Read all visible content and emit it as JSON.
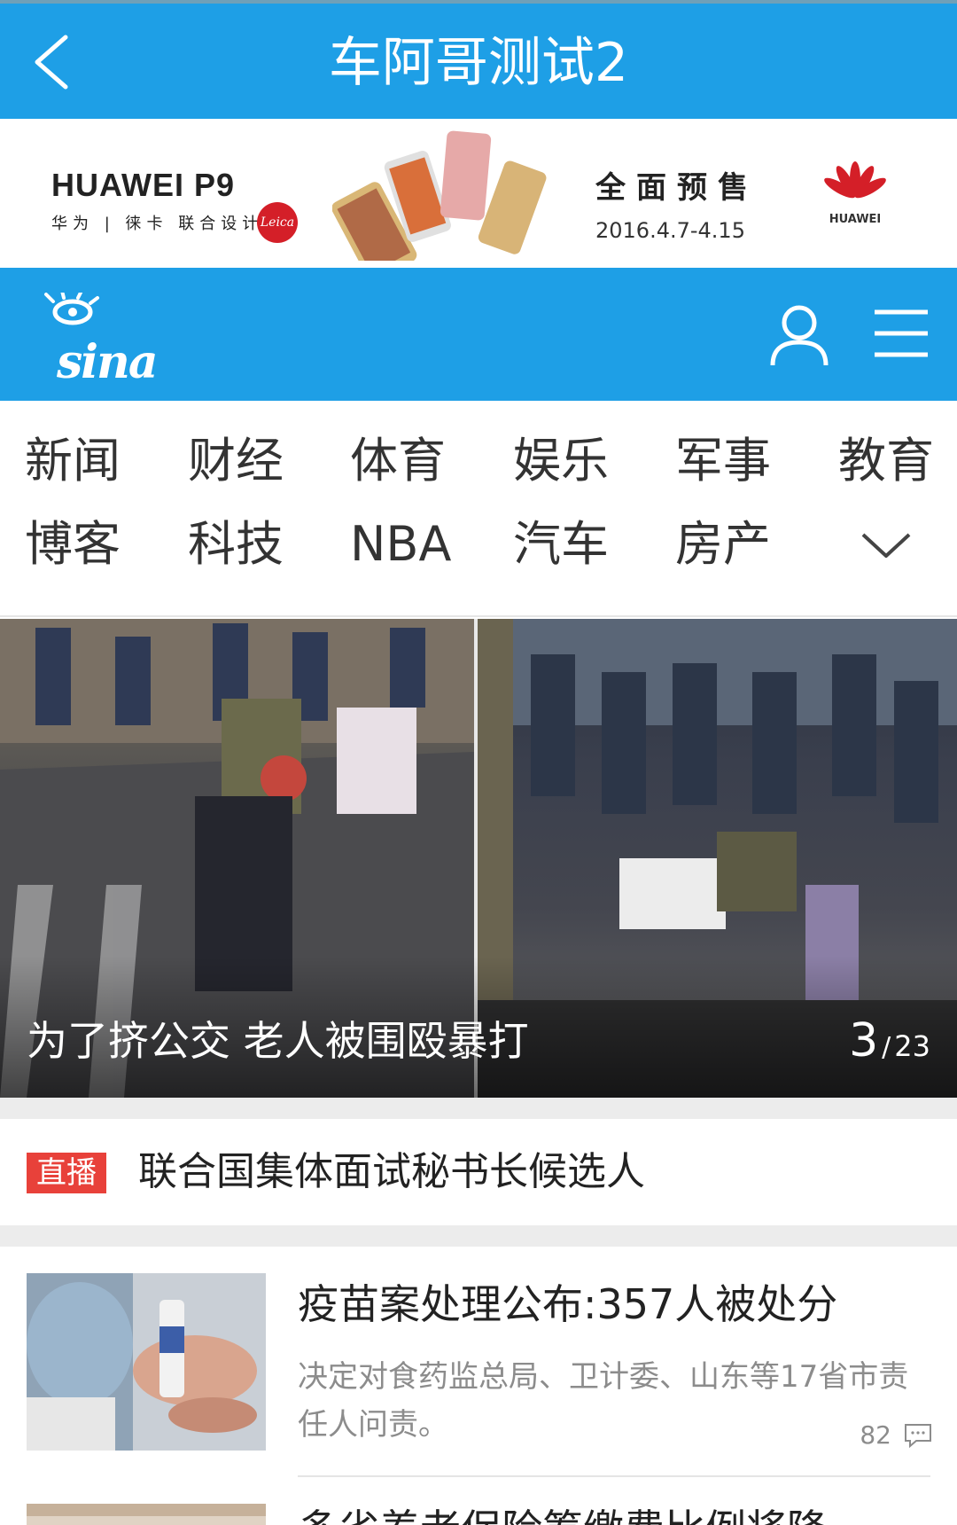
{
  "titlebar": {
    "title": "车阿哥测试2",
    "back_icon": "chevron-left-icon"
  },
  "ad": {
    "brand": "HUAWEI P9",
    "sub": "华为 | 徕卡 联合设计",
    "leica": "Leica",
    "sale": "全面预售",
    "date": "2016.4.7-4.15",
    "logo_text": "HUAWEI"
  },
  "sina": {
    "logo": "sina",
    "user_icon": "user-icon",
    "menu_icon": "menu-icon"
  },
  "categories": {
    "row1": [
      "新闻",
      "财经",
      "体育",
      "娱乐",
      "军事",
      "教育"
    ],
    "row2": [
      "博客",
      "科技",
      "NBA",
      "汽车",
      "房产"
    ],
    "expand_icon": "chevron-down-icon"
  },
  "slider": {
    "caption": "为了挤公交 老人被围殴暴打",
    "current": "3",
    "separator": "/",
    "total": "23"
  },
  "live": {
    "badge": "直播",
    "title": "联合国集体面试秘书长候选人"
  },
  "news": [
    {
      "title": "疫苗案处理公布:357人被处分",
      "desc": "决定对食药监总局、卫计委、山东等17省市责任人问责。",
      "comments": "82",
      "comment_icon": "comment-icon"
    },
    {
      "title": "多省养老保险筹缴费比例将降"
    }
  ],
  "colors": {
    "brand_blue": "#1e9fe6",
    "live_red": "#e8413a",
    "huawei_red": "#d41f28"
  }
}
